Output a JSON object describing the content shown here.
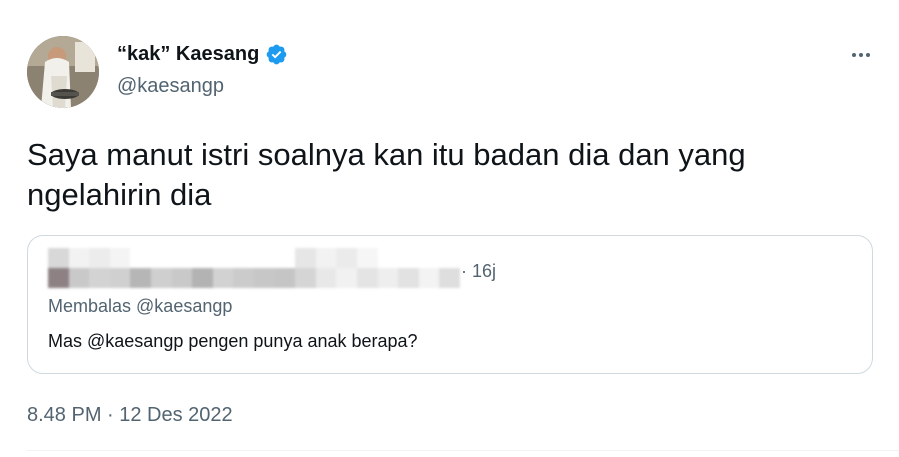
{
  "author": {
    "display_name": "“kak” Kaesang",
    "handle": "@kaesangp",
    "verified": true,
    "avatar_icon": "profile-photo"
  },
  "tweet": {
    "text": "Saya manut istri soalnya kan itu badan dia dan yang ngelahirin dia",
    "timestamp": "8.48 PM · 12 Des 2022"
  },
  "quoted_tweet": {
    "author_redacted": true,
    "time": "· 16j",
    "reply_to": "Membalas @kaesangp",
    "text": "Mas @kaesangp pengen punya anak berapa?"
  },
  "colors": {
    "text_primary": "#0f1419",
    "text_secondary": "#536471",
    "verified_blue": "#1d9bf0",
    "border": "#cfd9de"
  },
  "icons": {
    "more": "more-horizontal-icon",
    "verified": "verified-badge-icon"
  }
}
